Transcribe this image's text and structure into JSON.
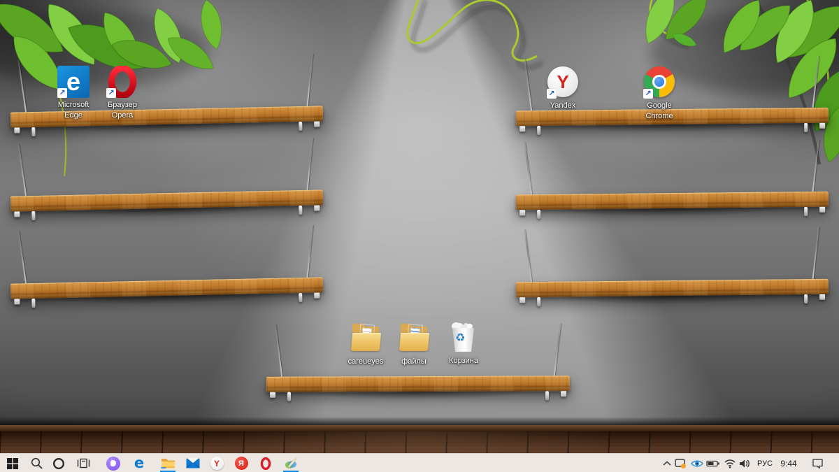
{
  "desktop_icons": [
    {
      "name": "microsoft-edge-shortcut",
      "line1": "Microsoft",
      "line2": "Edge"
    },
    {
      "name": "opera-shortcut",
      "line1": "Браузер",
      "line2": "Opera"
    },
    {
      "name": "yandex-browser-shortcut",
      "line1": "Yandex",
      "line2": ""
    },
    {
      "name": "google-chrome-shortcut",
      "line1": "Google",
      "line2": "Chrome"
    },
    {
      "name": "careueyes-folder",
      "line1": "careueyes",
      "line2": ""
    },
    {
      "name": "files-folder",
      "line1": "файлы",
      "line2": ""
    },
    {
      "name": "recycle-bin",
      "line1": "Корзина",
      "line2": ""
    }
  ],
  "taskbar": {
    "buttons": [
      "start",
      "search",
      "cortana",
      "task-view",
      "yandex-alice",
      "edge",
      "file-explorer",
      "mail",
      "yandex-browser",
      "yandex",
      "opera",
      "quill-app"
    ],
    "running_buttons": [
      "file-explorer",
      "quill-app"
    ],
    "tray": {
      "language": "РУС",
      "time": "9:44",
      "icons": [
        "hidden-icons-chevron",
        "careueyes-monitor",
        "eye-protection",
        "battery",
        "wifi",
        "volume",
        "notifications"
      ]
    }
  },
  "icons": {
    "shortcut_arrow": "↗",
    "recycle_symbol": "♻",
    "edge_letter": "e",
    "yandex_letter": "Y",
    "yandex_app_letter": "Я"
  },
  "colors": {
    "taskbar_bg": "#ece7e3",
    "running_underline": "#1283d8",
    "edge_blue": "#0a7bd5",
    "opera_red": "#d81f2a",
    "yandex_red": "#e0261f",
    "chrome_blue": "#1a6fe0",
    "alice_purple": "#8a5ce8",
    "shelf_wood": "#b5732a",
    "wall_gray": "#757575",
    "leaf_green": "#6dbb2d",
    "vine_green": "#aacb2e"
  }
}
